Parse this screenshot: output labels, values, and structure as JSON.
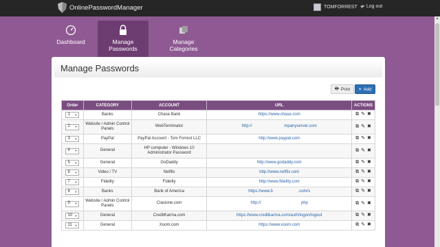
{
  "app": {
    "brand": "OnlinePasswordManager"
  },
  "topbar": {
    "user": "TOMFORREST",
    "logout": "Log out"
  },
  "nav": [
    {
      "label": "Dashboard",
      "icon": "gauge-icon"
    },
    {
      "label": "Manage Passwords",
      "icon": "padlock-icon"
    },
    {
      "label": "Manage Categories",
      "icon": "boxes-icon"
    }
  ],
  "page": {
    "title": "Manage Passwords"
  },
  "toolbar": {
    "print": "Print",
    "add": "Add"
  },
  "table": {
    "headers": [
      "Order",
      "CATEGORY",
      "ACCOUNT",
      "URL",
      "ACTIONS"
    ],
    "rows": [
      {
        "order": "1",
        "category": "Banks",
        "account": "Chase Bank",
        "url": "https://www.chase.com"
      },
      {
        "order": "2",
        "category": "Website / Admin Control Panels",
        "account": "WebTerminator",
        "url": "http://                            mpanyserver.com"
      },
      {
        "order": "3",
        "category": "PayPal",
        "account": "PayPal Account - Tom Forrest LLC",
        "url": "http://www.paypal.com"
      },
      {
        "order": "4",
        "category": "General",
        "account": "HP computer - Windows 10 Administrator Password",
        "url": ""
      },
      {
        "order": "5",
        "category": "General",
        "account": "GoDaddy",
        "url": "http://www.godaddy.com"
      },
      {
        "order": "6",
        "category": "Video / TV",
        "account": "Netflix",
        "url": "http://www.netflix.com"
      },
      {
        "order": "7",
        "category": "Fidelity",
        "account": "Fidelity",
        "url": "http://www.fidelity.com"
      },
      {
        "order": "8",
        "category": "Banks",
        "account": "Bank of America",
        "url": "https://www.b                      .com/s"
      },
      {
        "order": "9",
        "category": "Website / Admin Control Panels",
        "account": "Clasione.com",
        "url": "http://                                   php"
      },
      {
        "order": "10",
        "category": "General",
        "account": "CreditKarma.com",
        "url": "https://www.creditkarma.com/auth/logon/logout"
      },
      {
        "order": "11",
        "category": "General",
        "account": "Xoom.com",
        "url": "https://www.xoom.com"
      }
    ]
  },
  "colors": {
    "accent": "#8f5a93",
    "header_dark": "#262626",
    "add_button": "#2c6fb4"
  }
}
